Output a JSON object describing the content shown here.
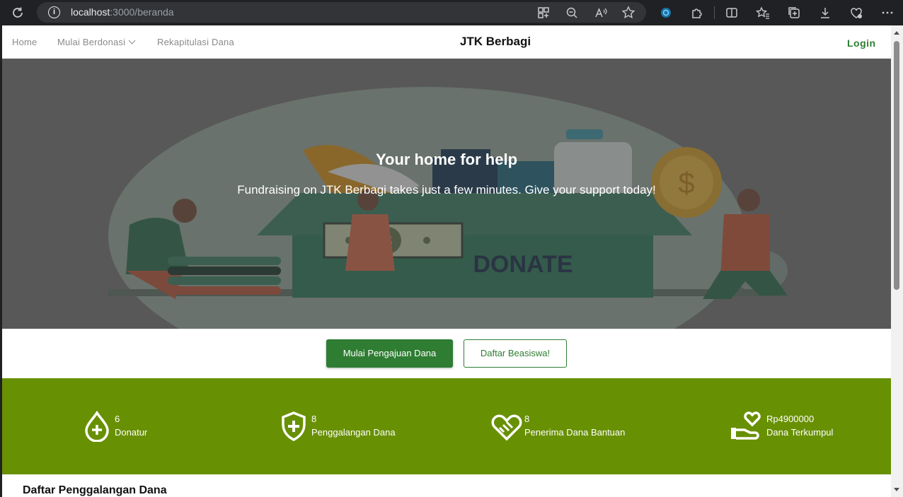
{
  "browser": {
    "url_host": "localhost",
    "url_rest": ":3000/beranda"
  },
  "navbar": {
    "home": "Home",
    "donate_menu": "Mulai Berdonasi",
    "recap": "Rekapitulasi Dana",
    "brand": "JTK Berbagi",
    "login": "Login"
  },
  "hero": {
    "title": "Your home for help",
    "subtitle": "Fundraising on JTK Berbagi takes just a few minutes. Give your support today!",
    "illustration_text": "DONATE"
  },
  "actions": {
    "primary": "Mulai Pengajuan Dana",
    "secondary": "Daftar Beasiswa!"
  },
  "stats": [
    {
      "value": "6",
      "label": "Donatur",
      "icon": "blood-drop-plus-icon"
    },
    {
      "value": "8",
      "label": "Penggalangan Dana",
      "icon": "shield-plus-icon"
    },
    {
      "value": "8",
      "label": "Penerima Dana Bantuan",
      "icon": "handshake-heart-icon"
    },
    {
      "value": "Rp4900000",
      "label": "Dana Terkumpul",
      "icon": "hand-heart-icon"
    }
  ],
  "section": {
    "title": "Daftar Penggalangan Dana"
  },
  "colors": {
    "primary": "#2e7d32",
    "stats_bg": "#689003"
  }
}
